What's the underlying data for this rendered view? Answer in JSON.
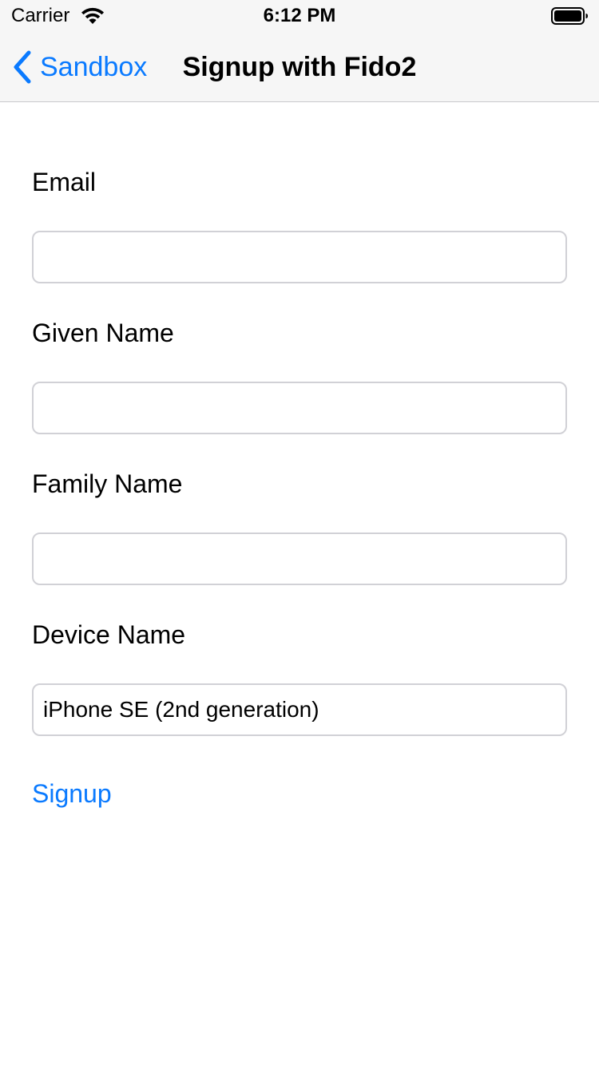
{
  "status_bar": {
    "carrier": "Carrier",
    "time": "6:12 PM",
    "wifi_icon": "wifi-icon",
    "battery_icon": "battery-full-icon"
  },
  "nav": {
    "back_label": "Sandbox",
    "back_icon": "chevron-left-icon",
    "title": "Signup with Fido2"
  },
  "form": {
    "email": {
      "label": "Email",
      "value": "",
      "placeholder": ""
    },
    "given_name": {
      "label": "Given Name",
      "value": "",
      "placeholder": ""
    },
    "family_name": {
      "label": "Family Name",
      "value": "",
      "placeholder": ""
    },
    "device_name": {
      "label": "Device Name",
      "value": "iPhone SE (2nd generation)",
      "placeholder": ""
    },
    "signup_label": "Signup"
  },
  "colors": {
    "accent": "#0a7aff",
    "nav_background": "#f6f6f6",
    "field_border": "#d1d1d6"
  }
}
